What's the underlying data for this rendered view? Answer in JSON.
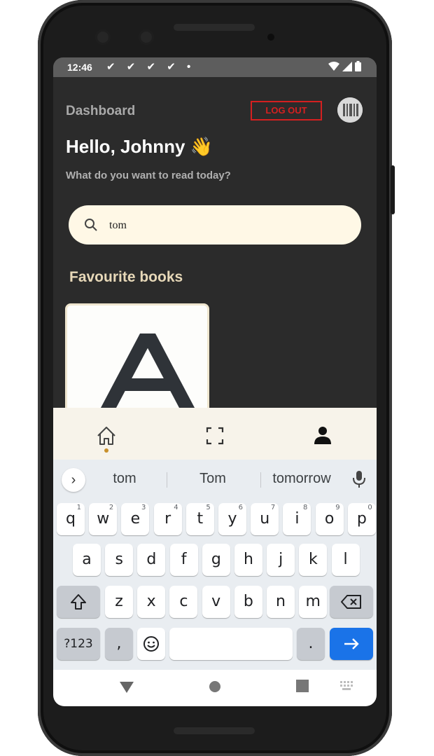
{
  "status_bar": {
    "time": "12:46",
    "notifications": "✔ ✔ ✔ ✔ •"
  },
  "header": {
    "title": "Dashboard",
    "logout_label": "LOG OUT"
  },
  "greeting": {
    "hello": "Hello, Johnny 👋",
    "prompt": "What do you want to read today?"
  },
  "search": {
    "value": "tom",
    "placeholder": ""
  },
  "favourites": {
    "title": "Favourite books"
  },
  "bottom_nav": {
    "items": [
      "home-icon",
      "scan-icon",
      "profile-icon"
    ],
    "active_index": 0,
    "accent": "#c8902c"
  },
  "keyboard": {
    "suggestions": [
      "tom",
      "Tom",
      "tomorrow"
    ],
    "row1": [
      "q",
      "w",
      "e",
      "r",
      "t",
      "y",
      "u",
      "i",
      "o",
      "p"
    ],
    "row1_hints": [
      "1",
      "2",
      "3",
      "4",
      "5",
      "6",
      "7",
      "8",
      "9",
      "0"
    ],
    "row2": [
      "a",
      "s",
      "d",
      "f",
      "g",
      "h",
      "j",
      "k",
      "l"
    ],
    "row3": [
      "z",
      "x",
      "c",
      "v",
      "b",
      "n",
      "m"
    ],
    "symbols_label": "?123",
    "comma_label": ",",
    "period_label": ".",
    "enter_color": "#1a73e8"
  },
  "colors": {
    "background": "#2b2b2b",
    "logout": "#d42020",
    "search_bg": "#fff8e6",
    "fav_title": "#e7d8b8"
  }
}
